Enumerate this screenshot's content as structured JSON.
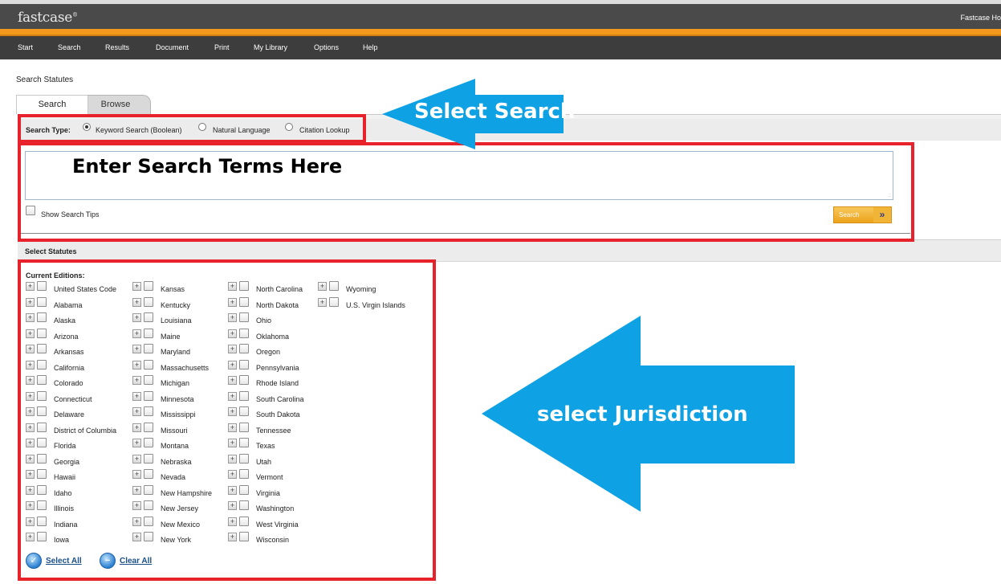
{
  "app": {
    "logo": "fastcase",
    "logo_mark": "®",
    "top_right_text": "Fastcase Ho"
  },
  "nav": {
    "items": [
      "Start",
      "Search",
      "Results",
      "Document",
      "Print",
      "My Library",
      "Options",
      "Help"
    ]
  },
  "page": {
    "title": "Search Statutes"
  },
  "tabs": [
    {
      "label": "Search",
      "active": true
    },
    {
      "label": "Browse",
      "active": false
    }
  ],
  "search_type": {
    "label": "Search Type:",
    "options": [
      {
        "label": "Keyword Search (Boolean)",
        "selected": true
      },
      {
        "label": "Natural Language",
        "selected": false
      },
      {
        "label": "Citation Lookup",
        "selected": false
      }
    ]
  },
  "query": {
    "value": "Enter Search Terms Here"
  },
  "tips": {
    "label": "Show Search Tips",
    "checked": false
  },
  "search_button": {
    "label": "Search",
    "arrows": "»"
  },
  "statutes": {
    "section_title": "Select Statutes",
    "editions_label": "Current Editions:",
    "columns": [
      [
        "United States Code",
        "Alabama",
        "Alaska",
        "Arizona",
        "Arkansas",
        "California",
        "Colorado",
        "Connecticut",
        "Delaware",
        "District of Columbia",
        "Florida",
        "Georgia",
        "Hawaii",
        "Idaho",
        "Illinois",
        "Indiana",
        "Iowa"
      ],
      [
        "Kansas",
        "Kentucky",
        "Louisiana",
        "Maine",
        "Maryland",
        "Massachusetts",
        "Michigan",
        "Minnesota",
        "Mississippi",
        "Missouri",
        "Montana",
        "Nebraska",
        "Nevada",
        "New Hampshire",
        "New Jersey",
        "New Mexico",
        "New York"
      ],
      [
        "North Carolina",
        "North Dakota",
        "Ohio",
        "Oklahoma",
        "Oregon",
        "Pennsylvania",
        "Rhode Island",
        "South Carolina",
        "South Dakota",
        "Tennessee",
        "Texas",
        "Utah",
        "Vermont",
        "Virginia",
        "Washington",
        "West Virginia",
        "Wisconsin"
      ],
      [
        "Wyoming",
        "U.S. Virgin Islands"
      ]
    ],
    "expander_symbol": "+",
    "select_all": "Select All",
    "clear_all": "Clear All"
  },
  "annotations": {
    "select_search": "Select Search",
    "select_jurisdiction": "select Jurisdiction",
    "box_color": "#e8222b",
    "arrow_color": "#0ea1e4"
  }
}
